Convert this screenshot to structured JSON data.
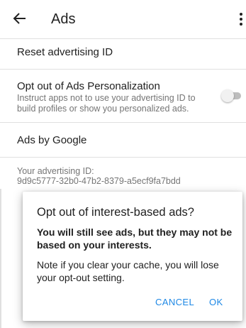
{
  "toolbar": {
    "title": "Ads",
    "back_icon": "arrow-back-icon",
    "overflow_icon": "more-vert-icon"
  },
  "settings": {
    "reset_label": "Reset advertising ID",
    "optout_title": "Opt out of Ads Personalization",
    "optout_desc_line1": "Instruct apps not to use your advertising ID to",
    "optout_desc_line2": "build profiles or show you personalized ads.",
    "optout_enabled": false,
    "ads_by_google": "Ads by Google",
    "ad_id_label": "Your advertising ID:",
    "ad_id_value": "9d9c5777-32b0-47b2-8379-a5ecf9fa7bdd"
  },
  "dialog": {
    "title": "Opt out of interest-based ads?",
    "message_bold_line1": "You will still see ads, but they may not be",
    "message_bold_line2": "based on your interests.",
    "message_line1": "Note if you clear your cache, you will lose",
    "message_line2": "your opt-out setting.",
    "cancel_label": "CANCEL",
    "ok_label": "OK"
  },
  "colors": {
    "accent": "#1e88e5",
    "divider": "#e0e0e0",
    "secondary_text": "#757575"
  }
}
